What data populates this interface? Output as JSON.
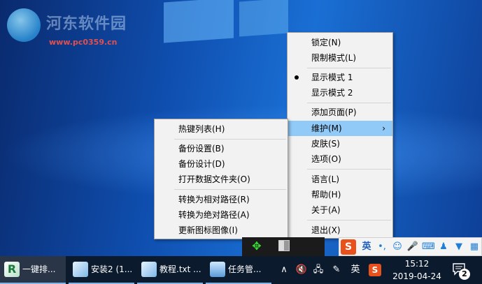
{
  "watermark": {
    "title": "河东软件园",
    "url": "www.pc0359.cn"
  },
  "main_menu": {
    "items": [
      {
        "label": "锁定(N)"
      },
      {
        "label": "限制模式(L)"
      },
      {
        "label": "显示模式 1",
        "checked": true
      },
      {
        "label": "显示模式 2"
      },
      {
        "label": "添加页面(P)"
      },
      {
        "label": "维护(M)",
        "highlighted": true,
        "submenu_arrow": "›"
      },
      {
        "label": "皮肤(S)"
      },
      {
        "label": "选项(O)"
      },
      {
        "label": "语言(L)"
      },
      {
        "label": "帮助(H)"
      },
      {
        "label": "关于(A)"
      },
      {
        "label": "退出(X)"
      }
    ]
  },
  "sub_menu": {
    "items": [
      {
        "label": "热键列表(H)"
      },
      {
        "label": "备份设置(B)"
      },
      {
        "label": "备份设计(D)"
      },
      {
        "label": "打开数据文件夹(O)"
      },
      {
        "label": "转换为相对路径(R)"
      },
      {
        "label": "转换为绝对路径(A)"
      },
      {
        "label": "更新图标图像(I)"
      }
    ]
  },
  "ime_bar": {
    "logo": "S",
    "lang": "英",
    "punct": "•,",
    "icons": [
      "smiley-icon",
      "microphone-icon",
      "keyboard-icon",
      "person-icon",
      "shirt-icon",
      "grid-icon"
    ]
  },
  "taskbar": {
    "buttons": [
      {
        "label": "一键排...",
        "icon": "app-r-icon",
        "active": true
      },
      {
        "label": "安装2 (1...",
        "icon": "notepad-icon"
      },
      {
        "label": "教程.txt ...",
        "icon": "notepad-icon"
      },
      {
        "label": "任务管...",
        "icon": "taskmanager-icon"
      }
    ],
    "tray": {
      "chevron": "∧",
      "lang": "英",
      "ime_logo": "S"
    },
    "clock": {
      "time": "15:12",
      "date": "2019-04-24"
    },
    "notifications": "2"
  },
  "colors": {
    "highlight": "#91c9f7",
    "menu_bg": "#f2f2f2",
    "taskbar_bg": "#0c1a2e",
    "sogou_orange": "#e8511c"
  }
}
